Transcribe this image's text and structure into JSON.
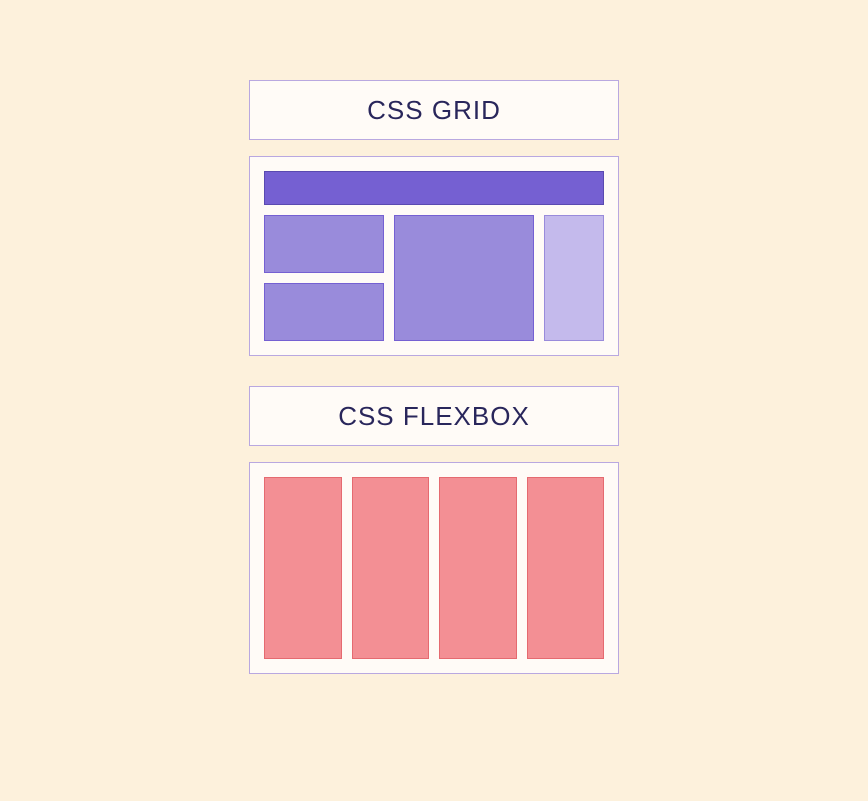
{
  "grid": {
    "label": "CSS GRID"
  },
  "flexbox": {
    "label": "CSS FLEXBOX"
  }
}
